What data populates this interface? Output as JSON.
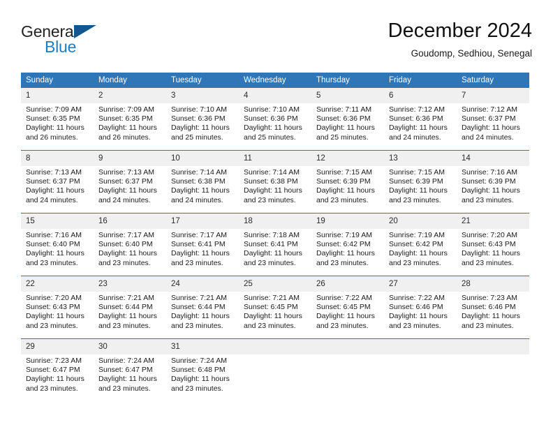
{
  "brand": {
    "name_top": "General",
    "name_bottom": "Blue",
    "flag_icon": "triangle-flag-icon"
  },
  "header": {
    "title": "December 2024",
    "subtitle": "Goudomp, Sedhiou, Senegal"
  },
  "colors": {
    "header_blue": "#2e76b8",
    "brand_blue": "#1d7cc6",
    "flag_blue": "#14578f",
    "daynum_band": "#f0f0f0"
  },
  "calendar": {
    "weekdays": [
      "Sunday",
      "Monday",
      "Tuesday",
      "Wednesday",
      "Thursday",
      "Friday",
      "Saturday"
    ],
    "weeks": [
      [
        {
          "day": "1",
          "sunrise": "Sunrise: 7:09 AM",
          "sunset": "Sunset: 6:35 PM",
          "daylight_1": "Daylight: 11 hours",
          "daylight_2": "and 26 minutes."
        },
        {
          "day": "2",
          "sunrise": "Sunrise: 7:09 AM",
          "sunset": "Sunset: 6:35 PM",
          "daylight_1": "Daylight: 11 hours",
          "daylight_2": "and 26 minutes."
        },
        {
          "day": "3",
          "sunrise": "Sunrise: 7:10 AM",
          "sunset": "Sunset: 6:36 PM",
          "daylight_1": "Daylight: 11 hours",
          "daylight_2": "and 25 minutes."
        },
        {
          "day": "4",
          "sunrise": "Sunrise: 7:10 AM",
          "sunset": "Sunset: 6:36 PM",
          "daylight_1": "Daylight: 11 hours",
          "daylight_2": "and 25 minutes."
        },
        {
          "day": "5",
          "sunrise": "Sunrise: 7:11 AM",
          "sunset": "Sunset: 6:36 PM",
          "daylight_1": "Daylight: 11 hours",
          "daylight_2": "and 25 minutes."
        },
        {
          "day": "6",
          "sunrise": "Sunrise: 7:12 AM",
          "sunset": "Sunset: 6:36 PM",
          "daylight_1": "Daylight: 11 hours",
          "daylight_2": "and 24 minutes."
        },
        {
          "day": "7",
          "sunrise": "Sunrise: 7:12 AM",
          "sunset": "Sunset: 6:37 PM",
          "daylight_1": "Daylight: 11 hours",
          "daylight_2": "and 24 minutes."
        }
      ],
      [
        {
          "day": "8",
          "sunrise": "Sunrise: 7:13 AM",
          "sunset": "Sunset: 6:37 PM",
          "daylight_1": "Daylight: 11 hours",
          "daylight_2": "and 24 minutes."
        },
        {
          "day": "9",
          "sunrise": "Sunrise: 7:13 AM",
          "sunset": "Sunset: 6:37 PM",
          "daylight_1": "Daylight: 11 hours",
          "daylight_2": "and 24 minutes."
        },
        {
          "day": "10",
          "sunrise": "Sunrise: 7:14 AM",
          "sunset": "Sunset: 6:38 PM",
          "daylight_1": "Daylight: 11 hours",
          "daylight_2": "and 24 minutes."
        },
        {
          "day": "11",
          "sunrise": "Sunrise: 7:14 AM",
          "sunset": "Sunset: 6:38 PM",
          "daylight_1": "Daylight: 11 hours",
          "daylight_2": "and 23 minutes."
        },
        {
          "day": "12",
          "sunrise": "Sunrise: 7:15 AM",
          "sunset": "Sunset: 6:39 PM",
          "daylight_1": "Daylight: 11 hours",
          "daylight_2": "and 23 minutes."
        },
        {
          "day": "13",
          "sunrise": "Sunrise: 7:15 AM",
          "sunset": "Sunset: 6:39 PM",
          "daylight_1": "Daylight: 11 hours",
          "daylight_2": "and 23 minutes."
        },
        {
          "day": "14",
          "sunrise": "Sunrise: 7:16 AM",
          "sunset": "Sunset: 6:39 PM",
          "daylight_1": "Daylight: 11 hours",
          "daylight_2": "and 23 minutes."
        }
      ],
      [
        {
          "day": "15",
          "sunrise": "Sunrise: 7:16 AM",
          "sunset": "Sunset: 6:40 PM",
          "daylight_1": "Daylight: 11 hours",
          "daylight_2": "and 23 minutes."
        },
        {
          "day": "16",
          "sunrise": "Sunrise: 7:17 AM",
          "sunset": "Sunset: 6:40 PM",
          "daylight_1": "Daylight: 11 hours",
          "daylight_2": "and 23 minutes."
        },
        {
          "day": "17",
          "sunrise": "Sunrise: 7:17 AM",
          "sunset": "Sunset: 6:41 PM",
          "daylight_1": "Daylight: 11 hours",
          "daylight_2": "and 23 minutes."
        },
        {
          "day": "18",
          "sunrise": "Sunrise: 7:18 AM",
          "sunset": "Sunset: 6:41 PM",
          "daylight_1": "Daylight: 11 hours",
          "daylight_2": "and 23 minutes."
        },
        {
          "day": "19",
          "sunrise": "Sunrise: 7:19 AM",
          "sunset": "Sunset: 6:42 PM",
          "daylight_1": "Daylight: 11 hours",
          "daylight_2": "and 23 minutes."
        },
        {
          "day": "20",
          "sunrise": "Sunrise: 7:19 AM",
          "sunset": "Sunset: 6:42 PM",
          "daylight_1": "Daylight: 11 hours",
          "daylight_2": "and 23 minutes."
        },
        {
          "day": "21",
          "sunrise": "Sunrise: 7:20 AM",
          "sunset": "Sunset: 6:43 PM",
          "daylight_1": "Daylight: 11 hours",
          "daylight_2": "and 23 minutes."
        }
      ],
      [
        {
          "day": "22",
          "sunrise": "Sunrise: 7:20 AM",
          "sunset": "Sunset: 6:43 PM",
          "daylight_1": "Daylight: 11 hours",
          "daylight_2": "and 23 minutes."
        },
        {
          "day": "23",
          "sunrise": "Sunrise: 7:21 AM",
          "sunset": "Sunset: 6:44 PM",
          "daylight_1": "Daylight: 11 hours",
          "daylight_2": "and 23 minutes."
        },
        {
          "day": "24",
          "sunrise": "Sunrise: 7:21 AM",
          "sunset": "Sunset: 6:44 PM",
          "daylight_1": "Daylight: 11 hours",
          "daylight_2": "and 23 minutes."
        },
        {
          "day": "25",
          "sunrise": "Sunrise: 7:21 AM",
          "sunset": "Sunset: 6:45 PM",
          "daylight_1": "Daylight: 11 hours",
          "daylight_2": "and 23 minutes."
        },
        {
          "day": "26",
          "sunrise": "Sunrise: 7:22 AM",
          "sunset": "Sunset: 6:45 PM",
          "daylight_1": "Daylight: 11 hours",
          "daylight_2": "and 23 minutes."
        },
        {
          "day": "27",
          "sunrise": "Sunrise: 7:22 AM",
          "sunset": "Sunset: 6:46 PM",
          "daylight_1": "Daylight: 11 hours",
          "daylight_2": "and 23 minutes."
        },
        {
          "day": "28",
          "sunrise": "Sunrise: 7:23 AM",
          "sunset": "Sunset: 6:46 PM",
          "daylight_1": "Daylight: 11 hours",
          "daylight_2": "and 23 minutes."
        }
      ],
      [
        {
          "day": "29",
          "sunrise": "Sunrise: 7:23 AM",
          "sunset": "Sunset: 6:47 PM",
          "daylight_1": "Daylight: 11 hours",
          "daylight_2": "and 23 minutes."
        },
        {
          "day": "30",
          "sunrise": "Sunrise: 7:24 AM",
          "sunset": "Sunset: 6:47 PM",
          "daylight_1": "Daylight: 11 hours",
          "daylight_2": "and 23 minutes."
        },
        {
          "day": "31",
          "sunrise": "Sunrise: 7:24 AM",
          "sunset": "Sunset: 6:48 PM",
          "daylight_1": "Daylight: 11 hours",
          "daylight_2": "and 23 minutes."
        },
        {
          "day": "",
          "sunrise": "",
          "sunset": "",
          "daylight_1": "",
          "daylight_2": ""
        },
        {
          "day": "",
          "sunrise": "",
          "sunset": "",
          "daylight_1": "",
          "daylight_2": ""
        },
        {
          "day": "",
          "sunrise": "",
          "sunset": "",
          "daylight_1": "",
          "daylight_2": ""
        },
        {
          "day": "",
          "sunrise": "",
          "sunset": "",
          "daylight_1": "",
          "daylight_2": ""
        }
      ]
    ]
  }
}
